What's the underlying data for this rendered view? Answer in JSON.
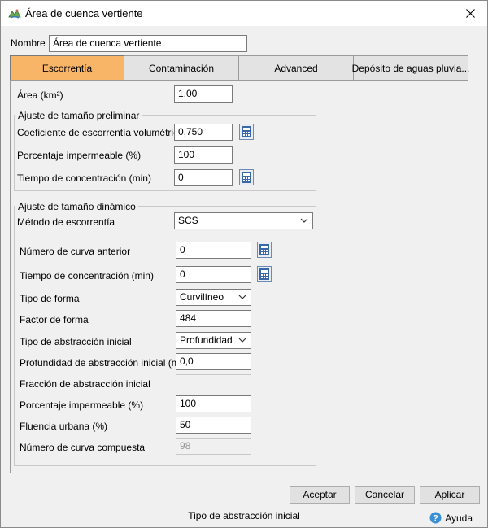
{
  "window": {
    "title": "Área de cuenca vertiente"
  },
  "header": {
    "name_label": "Nombre",
    "name_value": "Área de cuenca vertiente"
  },
  "tabs": [
    {
      "label": "Escorrentía"
    },
    {
      "label": "Contaminación"
    },
    {
      "label": "Advanced"
    },
    {
      "label": "Depósito de aguas pluvia..."
    }
  ],
  "area": {
    "label": "Área (km²)",
    "value": "1,00"
  },
  "preliminary": {
    "title": "Ajuste de tamaño preliminar",
    "runoff_coef_label": "Coeficiente de escorrentía volumétrica",
    "runoff_coef_value": "0,750",
    "impervious_label": "Porcentaje impermeable (%)",
    "impervious_value": "100",
    "tc_label": "Tiempo de concentración (min)",
    "tc_value": "0"
  },
  "dynamic": {
    "title": "Ajuste de tamaño dinámico",
    "method_label": "Método de escorrentía",
    "method_value": "SCS",
    "prev_curve_label": "Número de curva anterior",
    "prev_curve_value": "0",
    "tc_label": "Tiempo de concentración (min)",
    "tc_value": "0",
    "shape_type_label": "Tipo de forma",
    "shape_type_value": "Curvilíneo",
    "shape_factor_label": "Factor de forma",
    "shape_factor_value": "484",
    "abstraction_type_label": "Tipo de abstracción inicial",
    "abstraction_type_value": "Profundidad",
    "abstraction_depth_label": "Profundidad de abstracción inicial (mm)",
    "abstraction_depth_value": "0,0",
    "abstraction_fraction_label": "Fracción de abstracción inicial",
    "abstraction_fraction_value": "",
    "impervious_label": "Porcentaje impermeable (%)",
    "impervious_value": "100",
    "urban_flow_label": "Fluencia urbana (%)",
    "urban_flow_value": "50",
    "composite_curve_label": "Número de curva compuesta",
    "composite_curve_value": "98"
  },
  "buttons": {
    "accept": "Aceptar",
    "cancel": "Cancelar",
    "apply": "Aplicar"
  },
  "status": {
    "text": "Tipo de abstracción inicial",
    "help": "Ayuda"
  },
  "colors": {
    "active_tab": "#f8b467",
    "calc_icon": "#3a67a8",
    "help_icon": "#3b8fd6"
  },
  "icons": {
    "app": "watershed-icon",
    "calculator": "calculator-icon",
    "close": "close-icon",
    "help": "help-icon",
    "dropdown": "chevron-down-icon"
  }
}
